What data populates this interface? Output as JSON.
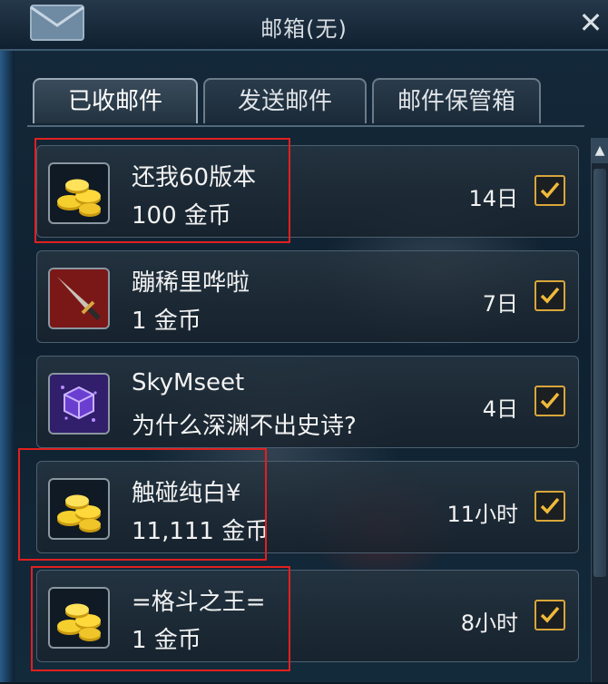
{
  "window": {
    "title": "邮箱(无)",
    "close_label": "✕"
  },
  "tabs": [
    {
      "label": "已收邮件",
      "active": true
    },
    {
      "label": "发送邮件",
      "active": false
    },
    {
      "label": "邮件保管箱",
      "active": false
    }
  ],
  "mails": [
    {
      "sender": "还我60版本",
      "content": "100 金币",
      "time": "14日",
      "icon": "gold-coins-icon",
      "checked": true,
      "highlighted": true
    },
    {
      "sender": "蹦稀里哗啦",
      "content": "1 金币",
      "time": "7日",
      "icon": "dagger-icon",
      "checked": true,
      "highlighted": false
    },
    {
      "sender": "SkyMseet",
      "content": "为什么深渊不出史诗?",
      "time": "4日",
      "icon": "purple-cube-icon",
      "checked": true,
      "highlighted": false
    },
    {
      "sender": "触碰纯白¥",
      "content": "11,111 金币",
      "time": "11小时",
      "icon": "gold-coins-icon",
      "checked": true,
      "highlighted": true
    },
    {
      "sender": "=格斗之王=",
      "content": "1 金币",
      "time": "8小时",
      "icon": "gold-coins-icon",
      "checked": true,
      "highlighted": true
    }
  ],
  "colors": {
    "accent_checkbox": "#d9a63a",
    "highlight_box": "#e02020"
  }
}
